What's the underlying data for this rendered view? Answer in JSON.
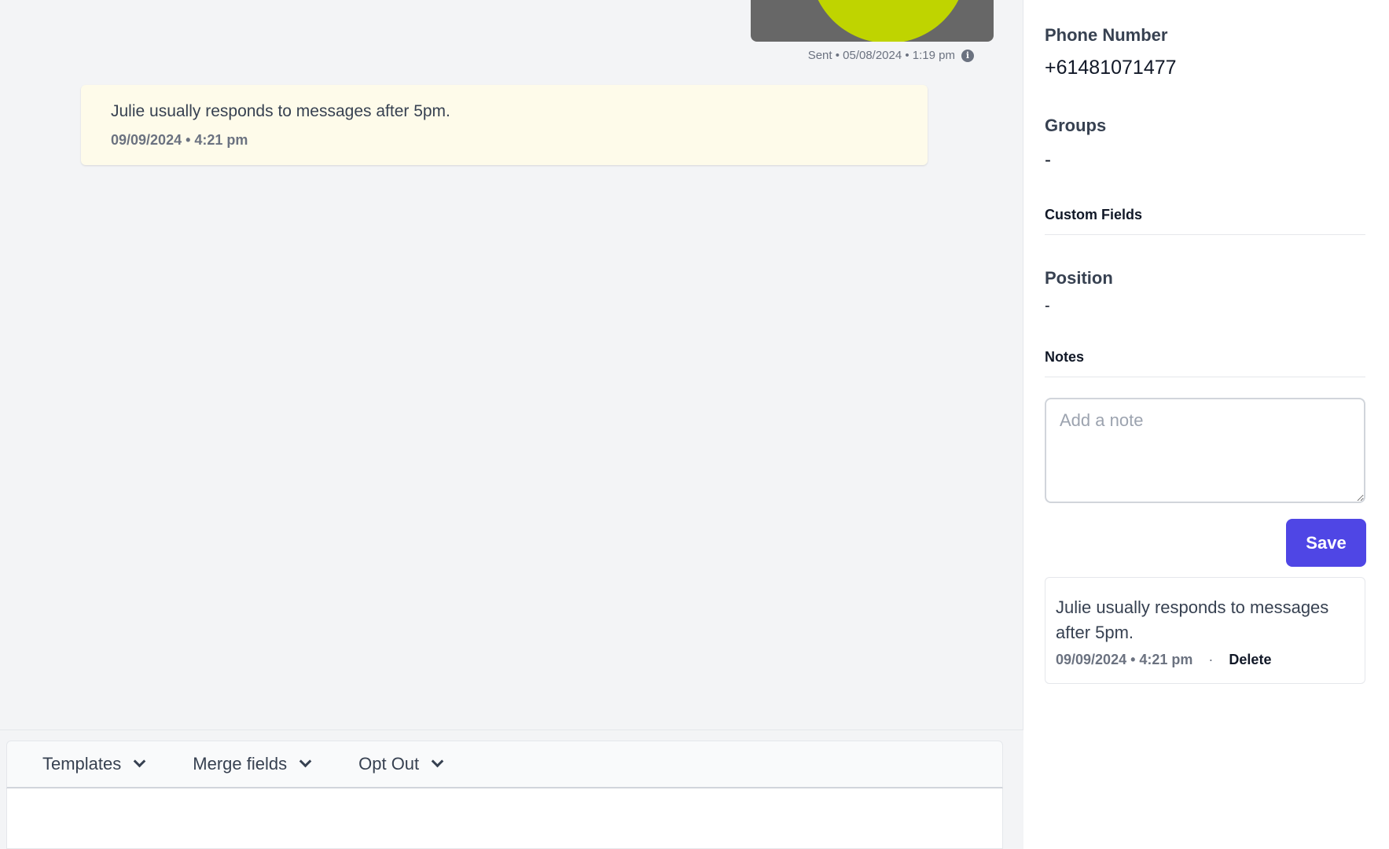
{
  "conversation": {
    "sent_meta": "Sent • 05/08/2024 • 1:19 pm",
    "note_card": {
      "text": "Julie usually responds to messages after 5pm.",
      "timestamp": "09/09/2024 • 4:21 pm"
    }
  },
  "composer": {
    "toolbar": [
      {
        "label": "Templates"
      },
      {
        "label": "Merge fields"
      },
      {
        "label": "Opt Out"
      }
    ]
  },
  "contact_panel": {
    "phone_label": "Phone Number",
    "phone_value": "+61481071477",
    "groups_label": "Groups",
    "groups_value": "-",
    "custom_fields_title": "Custom Fields",
    "position_label": "Position",
    "position_value": "-",
    "notes_title": "Notes",
    "note_placeholder": "Add a note",
    "save_label": "Save",
    "saved_note": {
      "text": "Julie usually responds to messages after 5pm.",
      "timestamp": "09/09/2024 • 4:21 pm",
      "separator": "·",
      "delete_label": "Delete"
    }
  },
  "colors": {
    "accent": "#4f46e5",
    "note_background": "#fefbea",
    "image_green": "#bfd400"
  },
  "icons": [
    "info-icon",
    "chevron-down-icon"
  ]
}
